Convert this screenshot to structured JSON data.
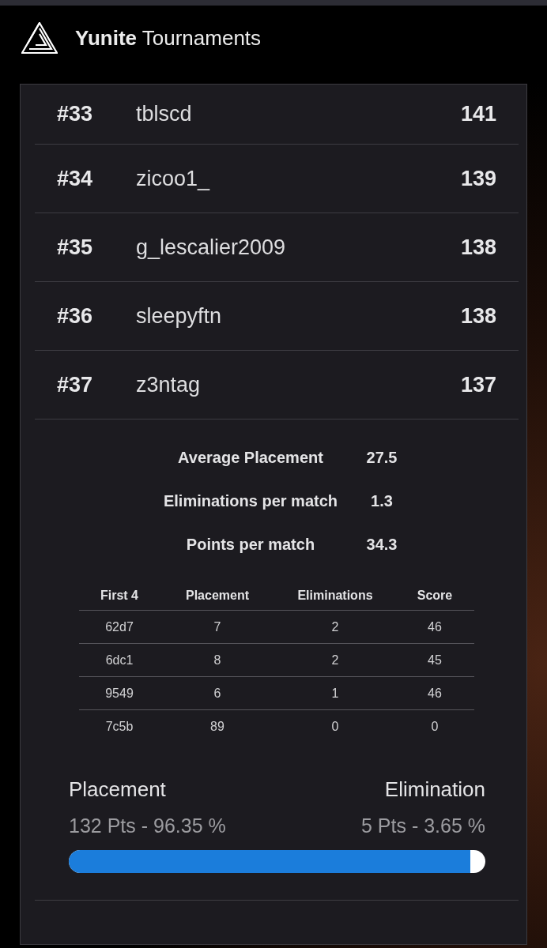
{
  "header": {
    "title": "**Yunite** Tournaments"
  },
  "leaderboard": {
    "rows": [
      {
        "rank": "#33",
        "name": "tblscd",
        "score": "141"
      },
      {
        "rank": "#34",
        "name": "zicoo1_",
        "score": "139"
      },
      {
        "rank": "#35",
        "name": "g_lescalier2009",
        "score": "138"
      },
      {
        "rank": "#36",
        "name": "sleepyftn",
        "score": "138"
      },
      {
        "rank": "#37",
        "name": "z3ntag",
        "score": "137",
        "details": {
          "stats": [
            {
              "label": "Average Placement",
              "value": "27.5"
            },
            {
              "label": "Eliminations per match",
              "value": "1.3"
            },
            {
              "label": "Points per match",
              "value": "34.3"
            }
          ],
          "matches_table": {
            "columns": [
              "First 4",
              "Placement",
              "Eliminations",
              "Score"
            ],
            "rows": [
              [
                "62d7",
                "7",
                "2",
                "46"
              ],
              [
                "6dc1",
                "8",
                "2",
                "45"
              ],
              [
                "9549",
                "6",
                "1",
                "46"
              ],
              [
                "7c5b",
                "89",
                "0",
                "0"
              ]
            ]
          },
          "breakdown": {
            "left": {
              "label": "Placement",
              "reading": "132 Pts - 96.35 %"
            },
            "right": {
              "label": "Elimination",
              "reading": "5 Pts - 3.65 %"
            },
            "level": 0.9635
          }
        }
      }
    ]
  }
}
